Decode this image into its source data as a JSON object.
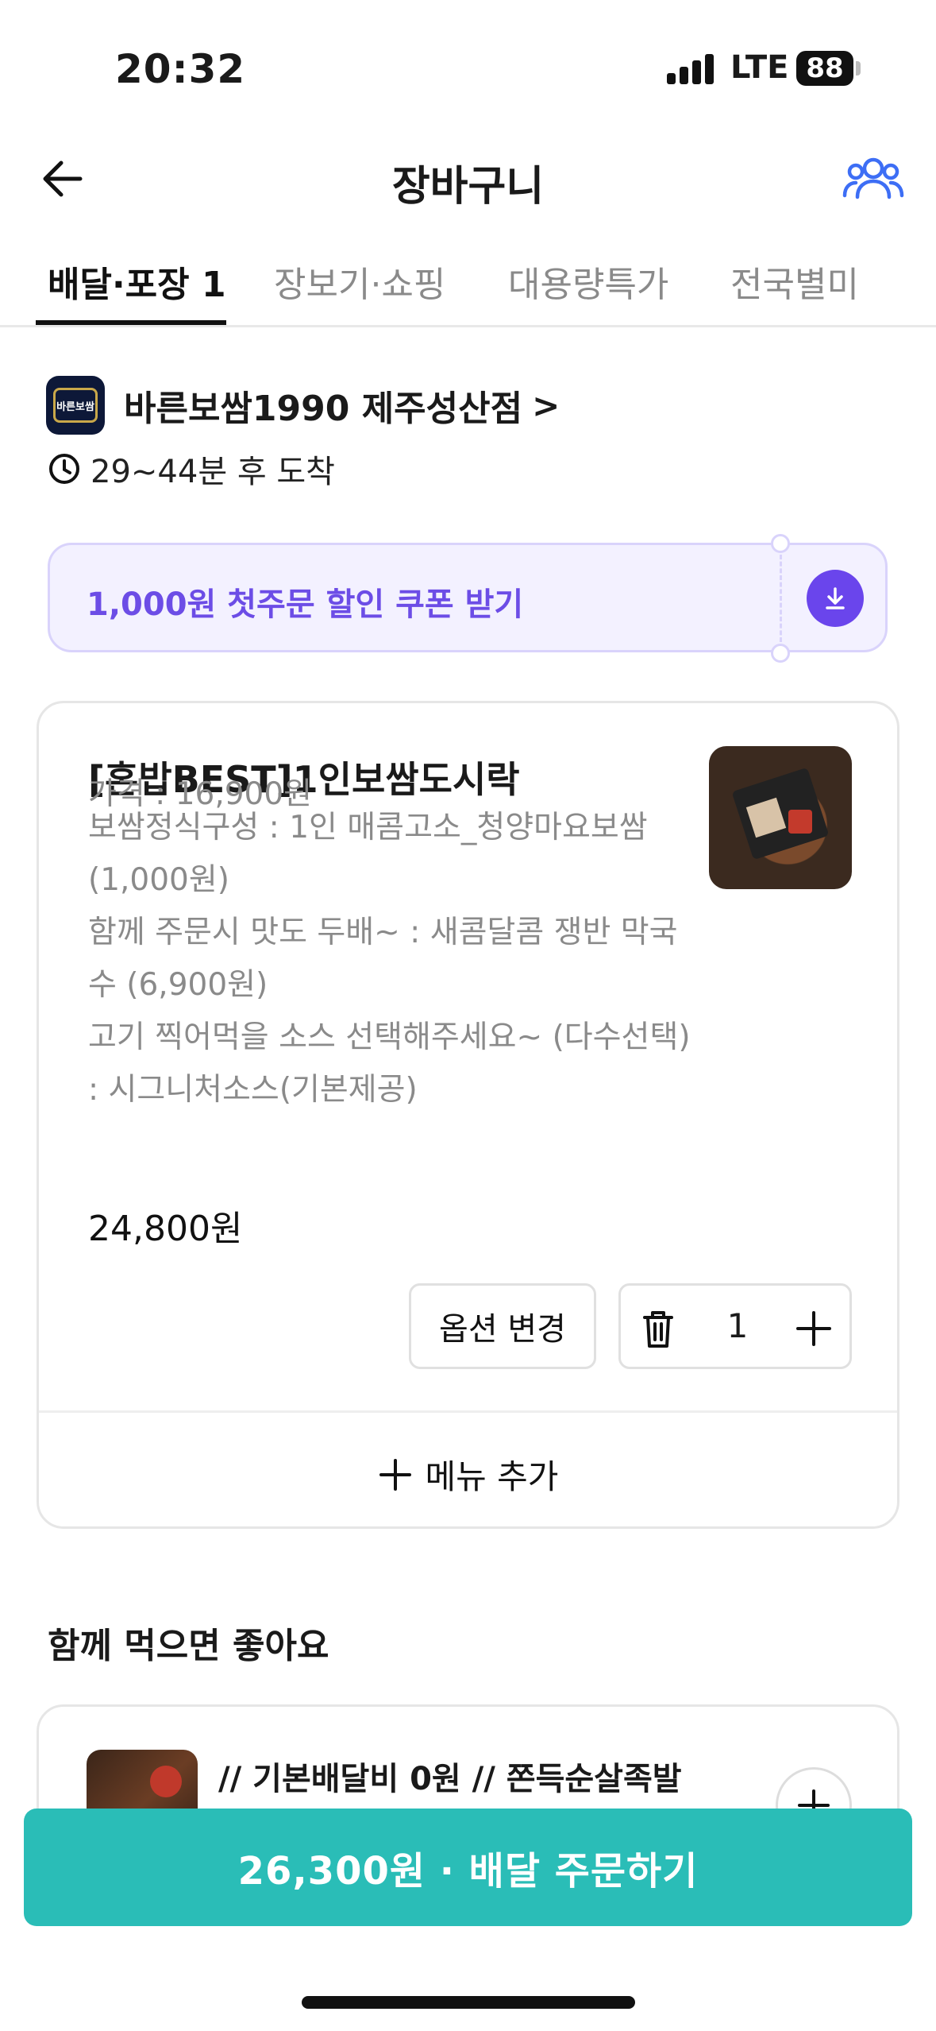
{
  "status_bar": {
    "time": "20:32",
    "network": "LTE",
    "battery": "88"
  },
  "header": {
    "title": "장바구니",
    "back_icon": "arrow-left-icon",
    "group_icon": "group-users-icon"
  },
  "tabs": [
    {
      "label": "배달·포장 1",
      "active": true
    },
    {
      "label": "장보기·쇼핑",
      "active": false
    },
    {
      "label": "대용량특가",
      "active": false
    },
    {
      "label": "전국별미",
      "active": false
    }
  ],
  "store": {
    "name": "바른보쌈1990 제주성산점",
    "chevron": ">",
    "eta": "29~44분 후 도착",
    "logo_text": "바른보쌈"
  },
  "coupon": {
    "text": "1,000원 첫주문 할인 쿠폰 받기",
    "accent": "#6a45ec"
  },
  "cart_item": {
    "name": "[혼밥BEST]1인보쌈도시락",
    "details": [
      "가격 : 16,900원",
      "보쌈정식구성 : 1인 매콤고소_청양마요보쌈 (1,000원)",
      "함께 주문시 맛도 두배~ : 새콤달콤 쟁반 막국수 (6,900원)",
      "고기 찍어먹을 소스 선택해주세요~ (다수선택) : 시그니처소스(기본제공)"
    ],
    "total": "24,800원",
    "option_button": "옵션 변경",
    "quantity": "1"
  },
  "add_menu": {
    "label": "메뉴 추가"
  },
  "recommend": {
    "title": "함께 먹으면 좋아요",
    "item_name": "// 기본배달비 0원 // 쫀득순살족발"
  },
  "order_button": {
    "label": "26,300원 · 배달 주문하기",
    "color": "#2abdb7"
  }
}
